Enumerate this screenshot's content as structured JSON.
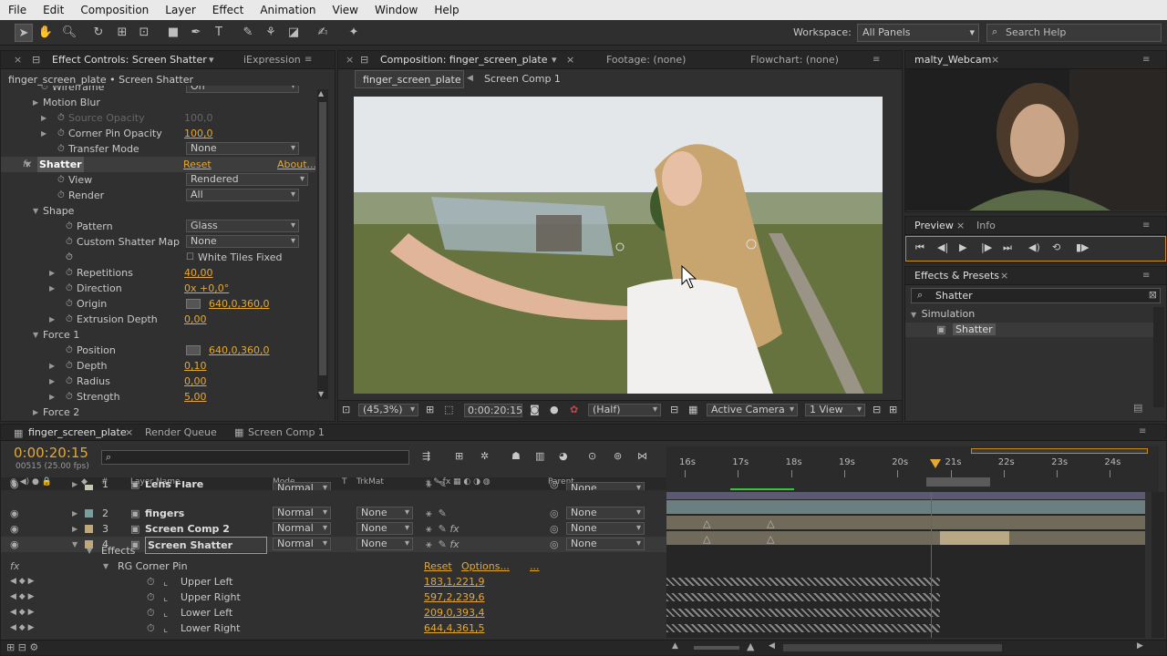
{
  "menu": [
    "File",
    "Edit",
    "Composition",
    "Layer",
    "Effect",
    "Animation",
    "View",
    "Window",
    "Help"
  ],
  "toolbar": {
    "workspace_label": "Workspace:",
    "workspace_value": "All Panels",
    "search_placeholder": "Search Help"
  },
  "effect_controls": {
    "tab_label": "Effect Controls: Screen Shatter",
    "tab2_label": "iExpression",
    "breadcrumb": "finger_screen_plate • Screen Shatter",
    "rows": [
      {
        "label": "Wireframe",
        "type": "dd",
        "value": "On"
      },
      {
        "label": "Motion Blur",
        "type": "group"
      },
      {
        "label": "Source Opacity",
        "type": "val",
        "value": "100,0",
        "dim": true
      },
      {
        "label": "Corner Pin Opacity",
        "type": "val",
        "value": "100,0"
      },
      {
        "label": "Transfer Mode",
        "type": "dd",
        "value": "None"
      },
      {
        "label": "Shatter",
        "type": "fx",
        "reset": "Reset",
        "about": "About..."
      },
      {
        "label": "View",
        "type": "dd",
        "value": "Rendered"
      },
      {
        "label": "Render",
        "type": "dd",
        "value": "All"
      },
      {
        "label": "Shape",
        "type": "group"
      },
      {
        "label": "Pattern",
        "type": "dd",
        "value": "Glass"
      },
      {
        "label": "Custom Shatter Map",
        "type": "dd",
        "value": "None"
      },
      {
        "label": "White Tiles Fixed",
        "type": "check"
      },
      {
        "label": "Repetitions",
        "type": "val",
        "value": "40,00"
      },
      {
        "label": "Direction",
        "type": "val",
        "value": "0x +0,0°"
      },
      {
        "label": "Origin",
        "type": "pt",
        "value": "640,0,360,0"
      },
      {
        "label": "Extrusion Depth",
        "type": "val",
        "value": "0,00"
      },
      {
        "label": "Force 1",
        "type": "group"
      },
      {
        "label": "Position",
        "type": "pt",
        "value": "640,0,360,0"
      },
      {
        "label": "Depth",
        "type": "val",
        "value": "0,10"
      },
      {
        "label": "Radius",
        "type": "val",
        "value": "0,00"
      },
      {
        "label": "Strength",
        "type": "val",
        "value": "5,00"
      },
      {
        "label": "Force 2",
        "type": "group"
      }
    ]
  },
  "composition": {
    "tab_label": "Composition: finger_screen_plate",
    "footage_tab": "Footage: (none)",
    "flowchart_tab": "Flowchart: (none)",
    "crumb1": "finger_screen_plate",
    "crumb2": "Screen Comp 1",
    "zoom": "(45,3%)",
    "timecode": "0:00:20:15",
    "resolution": "(Half)",
    "camera": "Active Camera",
    "views": "1 View"
  },
  "webcam": {
    "tab_label": "malty_Webcam"
  },
  "preview": {
    "tab_label": "Preview",
    "info_tab": "Info"
  },
  "effects_presets": {
    "tab_label": "Effects & Presets",
    "search_value": "Shatter",
    "category": "Simulation",
    "item": "Shatter"
  },
  "timeline": {
    "tabs": [
      "finger_screen_plate",
      "Render Queue",
      "Screen Comp 1"
    ],
    "timecode": "0:00:20:15",
    "frame_info": "00515 (25.00 fps)",
    "headers": {
      "layer_name": "Layer Name",
      "mode": "Mode",
      "t": "T",
      "trkmat": "TrkMat",
      "parent": "Parent",
      "num": "#"
    },
    "ruler": [
      "16s",
      "17s",
      "18s",
      "19s",
      "20s",
      "21s",
      "22s",
      "23s",
      "24s"
    ],
    "layers": [
      {
        "num": "1",
        "name": "Lens Flare",
        "mode": "Normal",
        "trkmat": "",
        "parent": "None"
      },
      {
        "num": "2",
        "name": "fingers",
        "mode": "Normal",
        "trkmat": "None",
        "parent": "None"
      },
      {
        "num": "3",
        "name": "Screen Comp 2",
        "mode": "Normal",
        "trkmat": "None",
        "parent": "None"
      },
      {
        "num": "4",
        "name": "Screen Shatter",
        "mode": "Normal",
        "trkmat": "None",
        "parent": "None"
      }
    ],
    "effects_label": "Effects",
    "effect_name": "RG Corner Pin",
    "effect_reset": "Reset",
    "effect_options": "Options...",
    "effect_more": "...",
    "props": [
      {
        "name": "Upper Left",
        "value": "183,1,221,9"
      },
      {
        "name": "Upper Right",
        "value": "597,2,239,6"
      },
      {
        "name": "Lower Left",
        "value": "209,0,393,4"
      },
      {
        "name": "Lower Right",
        "value": "644,4,361,5"
      }
    ]
  },
  "colors": {
    "accent": "#e5a834",
    "menubar": "#e9e9e9",
    "panel": "#303030",
    "playhead": "#e03030"
  }
}
